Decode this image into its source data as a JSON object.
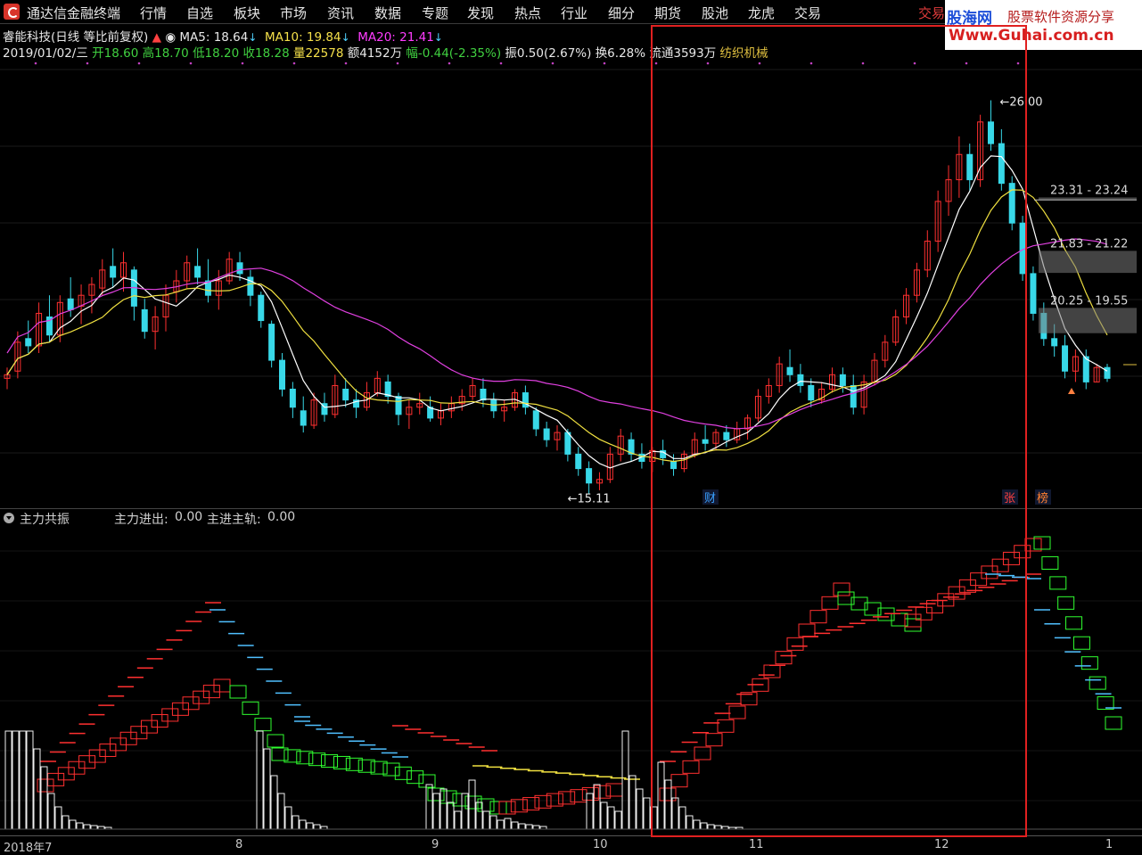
{
  "menubar": {
    "app_title": "通达信金融终端",
    "items": [
      "行情",
      "自选",
      "板块",
      "市场",
      "资讯",
      "数据",
      "专题",
      "发现",
      "热点",
      "行业",
      "细分",
      "期货",
      "股池",
      "龙虎",
      "交易"
    ],
    "trade_right": "交易"
  },
  "watermark": {
    "brand": "股海网",
    "slogan": "股票软件资源分享",
    "url": "Www.Guhai.com.cn"
  },
  "header": {
    "stock_name": "睿能科技(日线 等比前复权)",
    "ma5_label": "MA5: 18.64",
    "ma10_label": "MA10: 19.84",
    "ma20_label": "MA20: 21.41",
    "date": "2019/01/02/三",
    "open": "开18.60",
    "high": "高18.70",
    "low": "低18.20",
    "close": "收18.28",
    "volume": "量22578",
    "amount": "额4152万",
    "change": "幅-0.44(-2.35%)",
    "amplitude": "振0.50(2.67%)",
    "turnover": "换6.28%",
    "float": "流通3593万",
    "sector": "纺织机械"
  },
  "main_chart": {
    "high_marker": "26.00",
    "low_marker": "15.11",
    "band_labels": [
      "23.31 - 23.24",
      "21.83 - 21.22",
      "20.25 - 19.55"
    ],
    "badges": {
      "cai": "财",
      "zhang": "张",
      "bang": "榜"
    }
  },
  "indicator": {
    "name": "主力共振",
    "label_1": "主力进出:",
    "value_1": "0.00",
    "label_2": "主进主轨:",
    "value_2": "0.00"
  },
  "x_axis": {
    "labels": [
      "2018年7",
      "8",
      "9",
      "10",
      "11",
      "12",
      "1"
    ]
  },
  "colors": {
    "up": "#ff3030",
    "down": "#38d8e8",
    "ma5": "#ffffff",
    "ma10": "#f0e040",
    "ma20": "#e040e0",
    "highlight_box": "#e02020"
  },
  "chart_data": {
    "type": "candlestick",
    "ylim": [
      15,
      27
    ],
    "candles": [
      [
        18.3,
        18.6,
        18.0,
        18.4
      ],
      [
        18.5,
        19.6,
        18.3,
        19.3
      ],
      [
        19.4,
        19.9,
        19.0,
        19.2
      ],
      [
        19.2,
        20.4,
        19.0,
        20.1
      ],
      [
        20.0,
        20.6,
        19.3,
        19.5
      ],
      [
        19.5,
        20.6,
        19.3,
        20.4
      ],
      [
        20.5,
        21.1,
        20.0,
        20.2
      ],
      [
        20.3,
        20.9,
        19.8,
        20.6
      ],
      [
        20.6,
        21.1,
        20.1,
        20.9
      ],
      [
        20.8,
        21.6,
        20.6,
        21.3
      ],
      [
        21.4,
        21.9,
        20.8,
        21.1
      ],
      [
        21.1,
        21.8,
        20.7,
        21.5
      ],
      [
        21.3,
        21.4,
        19.9,
        20.3
      ],
      [
        20.2,
        20.5,
        19.4,
        19.6
      ],
      [
        19.6,
        20.3,
        19.1,
        20.0
      ],
      [
        20.0,
        20.9,
        19.6,
        20.6
      ],
      [
        20.7,
        21.3,
        20.4,
        21.0
      ],
      [
        21.0,
        21.7,
        20.8,
        21.5
      ],
      [
        21.4,
        21.9,
        20.9,
        21.1
      ],
      [
        21.0,
        21.6,
        20.4,
        20.6
      ],
      [
        20.6,
        21.3,
        20.2,
        21.0
      ],
      [
        21.0,
        21.8,
        20.9,
        21.6
      ],
      [
        21.5,
        21.8,
        21.0,
        21.2
      ],
      [
        21.1,
        21.3,
        20.3,
        20.6
      ],
      [
        20.6,
        20.7,
        19.7,
        19.9
      ],
      [
        19.8,
        19.9,
        18.6,
        18.8
      ],
      [
        18.8,
        19.0,
        17.8,
        18.0
      ],
      [
        18.0,
        18.2,
        17.2,
        17.5
      ],
      [
        17.4,
        17.8,
        16.8,
        17.0
      ],
      [
        17.0,
        17.9,
        16.9,
        17.7
      ],
      [
        17.6,
        17.9,
        17.1,
        17.3
      ],
      [
        17.3,
        18.4,
        17.2,
        18.1
      ],
      [
        18.0,
        18.3,
        17.5,
        17.7
      ],
      [
        17.7,
        18.0,
        17.2,
        17.5
      ],
      [
        17.5,
        18.2,
        17.4,
        17.9
      ],
      [
        17.9,
        18.5,
        17.8,
        18.3
      ],
      [
        18.2,
        18.4,
        17.6,
        17.8
      ],
      [
        17.8,
        17.9,
        17.0,
        17.3
      ],
      [
        17.3,
        17.7,
        16.9,
        17.5
      ],
      [
        17.5,
        17.9,
        17.3,
        17.6
      ],
      [
        17.5,
        17.8,
        17.1,
        17.2
      ],
      [
        17.2,
        17.6,
        17.0,
        17.4
      ],
      [
        17.4,
        17.8,
        17.2,
        17.6
      ],
      [
        17.6,
        18.0,
        17.4,
        17.8
      ],
      [
        17.8,
        18.3,
        17.7,
        18.1
      ],
      [
        18.0,
        18.3,
        17.5,
        17.7
      ],
      [
        17.7,
        17.9,
        17.2,
        17.4
      ],
      [
        17.4,
        17.7,
        17.1,
        17.5
      ],
      [
        17.5,
        18.0,
        17.4,
        17.9
      ],
      [
        17.9,
        18.1,
        17.3,
        17.5
      ],
      [
        17.4,
        17.5,
        16.7,
        16.9
      ],
      [
        16.9,
        17.1,
        16.4,
        16.6
      ],
      [
        16.6,
        17.0,
        16.3,
        16.8
      ],
      [
        16.8,
        16.9,
        16.0,
        16.2
      ],
      [
        16.2,
        16.4,
        15.6,
        15.8
      ],
      [
        15.8,
        16.0,
        15.1,
        15.4
      ],
      [
        15.4,
        15.7,
        15.2,
        15.5
      ],
      [
        15.5,
        16.4,
        15.4,
        16.2
      ],
      [
        16.2,
        16.9,
        16.0,
        16.7
      ],
      [
        16.6,
        16.8,
        16.0,
        16.2
      ],
      [
        16.2,
        16.5,
        15.8,
        16.0
      ],
      [
        16.0,
        16.4,
        15.7,
        16.3
      ],
      [
        16.3,
        16.6,
        15.9,
        16.1
      ],
      [
        16.0,
        16.2,
        15.6,
        15.8
      ],
      [
        15.8,
        16.3,
        15.7,
        16.2
      ],
      [
        16.2,
        16.8,
        16.1,
        16.6
      ],
      [
        16.6,
        17.0,
        16.3,
        16.5
      ],
      [
        16.5,
        16.9,
        16.3,
        16.8
      ],
      [
        16.8,
        17.0,
        16.4,
        16.6
      ],
      [
        16.6,
        17.1,
        16.5,
        16.9
      ],
      [
        16.9,
        17.3,
        16.6,
        17.2
      ],
      [
        17.2,
        18.0,
        17.1,
        17.8
      ],
      [
        17.8,
        18.3,
        17.6,
        18.1
      ],
      [
        18.1,
        18.9,
        17.9,
        18.7
      ],
      [
        18.6,
        19.1,
        18.2,
        18.4
      ],
      [
        18.4,
        18.7,
        17.9,
        18.1
      ],
      [
        18.1,
        18.3,
        17.5,
        17.7
      ],
      [
        17.7,
        18.2,
        17.6,
        18.0
      ],
      [
        18.0,
        18.6,
        17.9,
        18.4
      ],
      [
        18.4,
        18.6,
        17.9,
        18.1
      ],
      [
        18.1,
        18.4,
        17.3,
        17.5
      ],
      [
        17.5,
        18.4,
        17.3,
        18.2
      ],
      [
        18.2,
        19.0,
        18.1,
        18.8
      ],
      [
        18.8,
        19.5,
        18.6,
        19.3
      ],
      [
        19.3,
        20.2,
        19.2,
        20.0
      ],
      [
        20.0,
        20.8,
        19.8,
        20.6
      ],
      [
        20.6,
        21.5,
        20.4,
        21.3
      ],
      [
        21.3,
        22.4,
        21.1,
        22.1
      ],
      [
        22.1,
        23.5,
        21.8,
        23.2
      ],
      [
        23.2,
        24.2,
        22.8,
        23.8
      ],
      [
        23.8,
        25.0,
        23.3,
        24.5
      ],
      [
        24.5,
        24.8,
        23.5,
        23.8
      ],
      [
        23.8,
        25.6,
        23.6,
        25.4
      ],
      [
        25.4,
        26.0,
        24.6,
        24.8
      ],
      [
        24.8,
        25.2,
        23.5,
        23.7
      ],
      [
        23.7,
        23.9,
        22.4,
        22.6
      ],
      [
        22.6,
        22.8,
        21.0,
        21.2
      ],
      [
        21.2,
        21.4,
        19.9,
        20.1
      ],
      [
        20.1,
        20.4,
        19.2,
        19.4
      ],
      [
        19.4,
        19.8,
        18.9,
        19.2
      ],
      [
        19.2,
        19.5,
        18.3,
        18.5
      ],
      [
        18.5,
        19.1,
        18.2,
        18.9
      ],
      [
        18.9,
        19.1,
        18.0,
        18.2
      ],
      [
        18.2,
        18.7,
        18.2,
        18.6
      ],
      [
        18.6,
        18.7,
        18.2,
        18.3
      ]
    ]
  }
}
